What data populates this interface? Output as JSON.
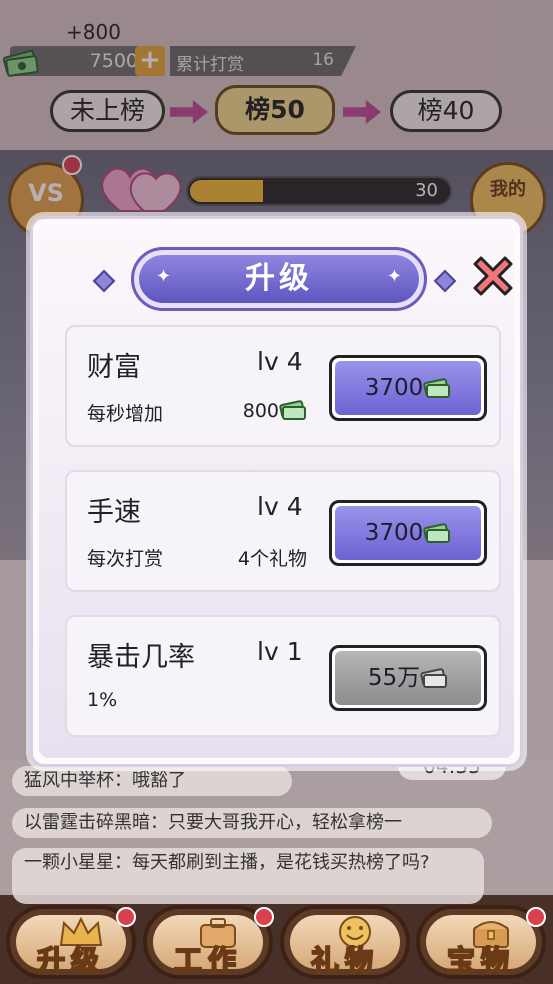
{
  "hud": {
    "money_gain": "+800",
    "money": "7500",
    "plus": "+",
    "reward_label": "累计打赏",
    "reward_count": "16",
    "progress_value": "30",
    "progress_fraction": 0.28,
    "heart_label": "真爱"
  },
  "ranks": [
    {
      "label": "未上榜",
      "active": false
    },
    {
      "label": "榜50",
      "active": true
    },
    {
      "label": "榜40",
      "active": false
    }
  ],
  "side": {
    "vs_label": "VS",
    "follow_label": "我的"
  },
  "modal": {
    "title": "升级",
    "cards": [
      {
        "name": "财富",
        "level": "lv 4",
        "desc": "每秒增加",
        "value": "800",
        "value_has_cash": true,
        "cost": "3700",
        "enabled": true
      },
      {
        "name": "手速",
        "level": "lv 4",
        "desc": "每次打赏",
        "value": "4个礼物",
        "value_has_cash": false,
        "cost": "3700",
        "enabled": true
      },
      {
        "name": "暴击几率",
        "level": "lv 1",
        "desc": "1%",
        "value": "",
        "value_has_cash": false,
        "cost": "55万",
        "enabled": false
      }
    ]
  },
  "timer": "04:35",
  "chat": [
    "猛风中举杯：哦豁了",
    "以雷霆击碎黑暗：只要大哥我开心，轻松拿榜一",
    "一颗小星星：每天都刷到主播，是花钱买热榜了吗?"
  ],
  "nav": [
    {
      "label": "升级",
      "icon": "crown-icon"
    },
    {
      "label": "工作",
      "icon": "briefcase-icon"
    },
    {
      "label": "礼物",
      "icon": "smile-gift-icon"
    },
    {
      "label": "宝物",
      "icon": "treasure-chest-icon"
    }
  ],
  "colors": {
    "accent_purple": "#6c63d2",
    "gold": "#f0b838",
    "badge_red": "#d9414d",
    "nav_brown": "#5c3a26"
  }
}
